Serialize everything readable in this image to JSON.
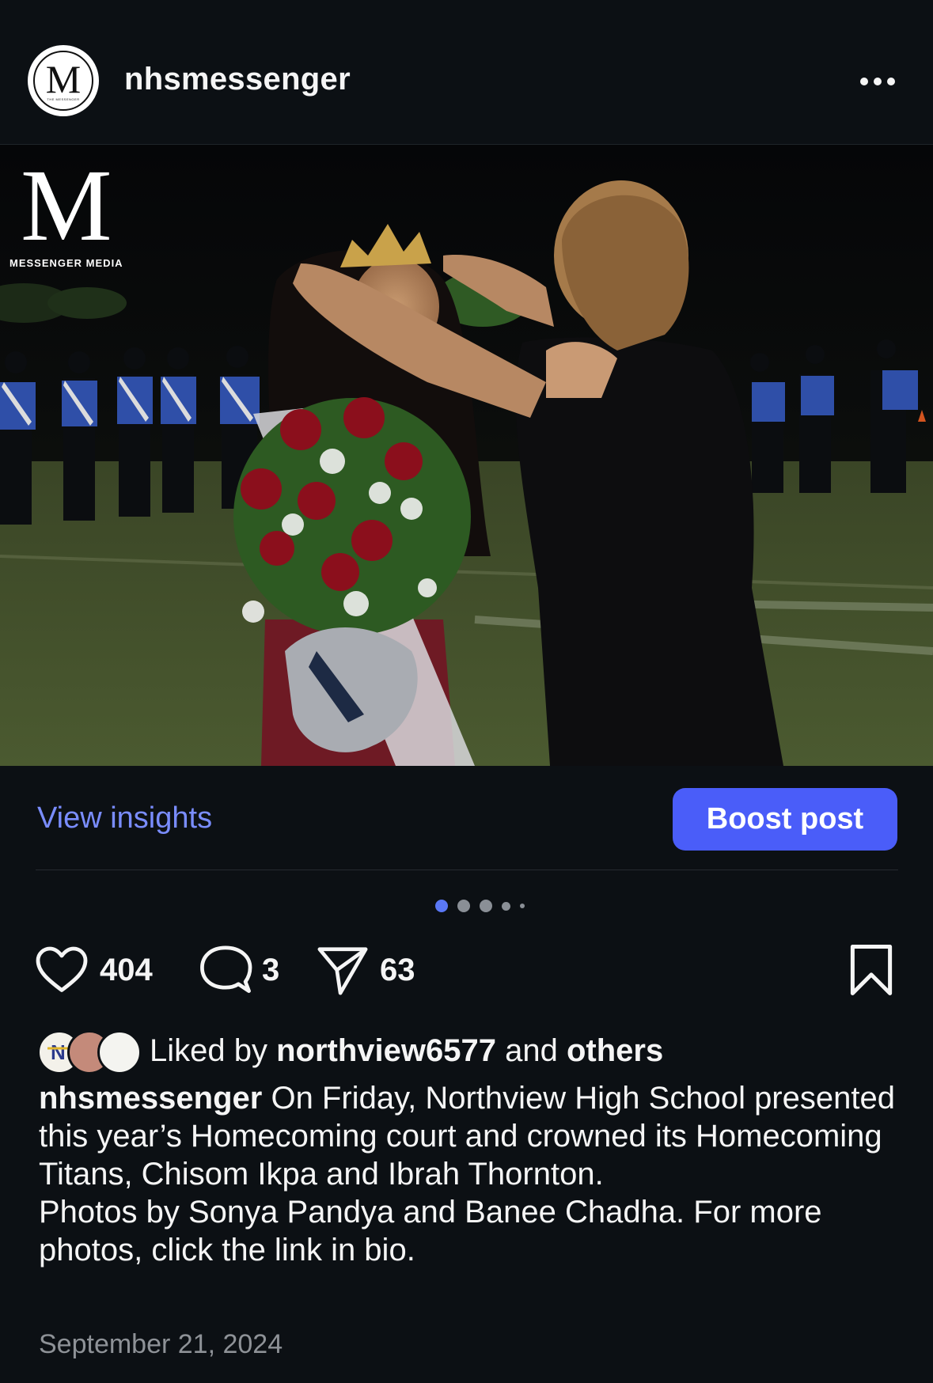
{
  "header": {
    "username": "nhsmessenger",
    "avatar_letter": "M",
    "avatar_subtext": "THE MESSENGER",
    "more_icon": "more-horizontal-icon"
  },
  "post": {
    "watermark_letter": "M",
    "watermark_text": "MESSENGER MEDIA",
    "image_description_icon": "photo"
  },
  "insights_label": "View insights",
  "boost_label": "Boost post",
  "carousel": {
    "total": 5,
    "active": 1
  },
  "actions": {
    "likes": "404",
    "comments": "3",
    "shares": "63"
  },
  "liked_by": {
    "prefix": "Liked by ",
    "user": "northview6577",
    "middle": " and ",
    "others": "others"
  },
  "caption": {
    "username": "nhsmessenger",
    "text1": " On Friday, Northview High School presented this year’s Homecoming court and crowned its Homecoming Titans, Chisom Ikpa and Ibrah Thornton.",
    "text2": "Photos by Sonya Pandya and Banee Chadha. For more photos, click the link in bio."
  },
  "date": "September 21, 2024",
  "colors": {
    "background": "#0c1014",
    "accent": "#4a5df9",
    "link": "#7a8dff"
  }
}
